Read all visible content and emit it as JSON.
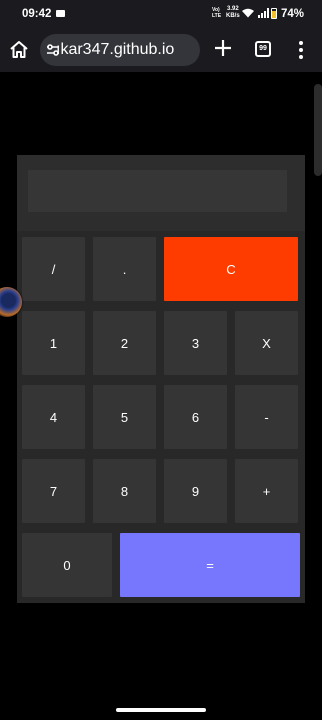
{
  "status_bar": {
    "time": "09:42",
    "notification_icon": "media-notification-icon",
    "volte": [
      "Vo)",
      "LTE"
    ],
    "net_speed_value": "3.92",
    "net_speed_unit": "KB/s",
    "wifi_icon": "wifi-icon",
    "signal_icon": "cellular-signal-icon",
    "battery_icon": "battery-icon",
    "battery": "74%"
  },
  "browser": {
    "home_icon": "home-icon",
    "site_settings_icon": "tune-icon",
    "url": "ıkar347.github.io",
    "new_tab_icon": "plus-icon",
    "tab_count": "99",
    "menu_icon": "more-vert-icon"
  },
  "calculator": {
    "display": "",
    "colors": {
      "clear": "#ff3c00",
      "equals": "#7777fd",
      "key": "#353535",
      "body": "#2d2d2d"
    },
    "keys": {
      "divide": "/",
      "decimal": ".",
      "clear": "C",
      "one": "1",
      "two": "2",
      "three": "3",
      "multiply": "X",
      "four": "4",
      "five": "5",
      "six": "6",
      "minus": "-",
      "seven": "7",
      "eight": "8",
      "nine": "9",
      "plus": "+",
      "zero": "0",
      "equals": "="
    }
  }
}
